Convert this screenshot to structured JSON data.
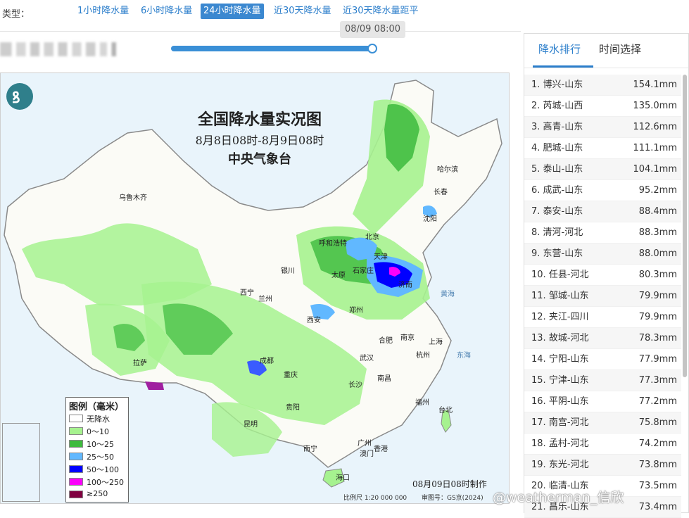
{
  "type_bar": {
    "label": "类型：",
    "tabs": [
      "1小时降水量",
      "6小时降水量",
      "24小时降水量",
      "近30天降水量",
      "近30天降水量距平"
    ],
    "active_index": 2
  },
  "timeline": {
    "current_time": "08/09 08:00",
    "progress": 1.0
  },
  "map": {
    "title": "全国降水量实况图",
    "subtitle": "8月8日08时-8月9日08时",
    "organization": "中央气象台",
    "made_time": "08月09日08时制作",
    "scale": "比例尺 1:20 000 000",
    "review_code": "审图号：GS京(2024)",
    "cities": [
      "哈尔滨",
      "长春",
      "沈阳",
      "乌鲁木齐",
      "呼和浩特",
      "北京",
      "天津",
      "银川",
      "太原",
      "石家庄",
      "西宁",
      "兰州",
      "西安",
      "郑州",
      "济南",
      "拉萨",
      "成都",
      "重庆",
      "武汉",
      "合肥",
      "南京",
      "上海",
      "杭州",
      "长沙",
      "南昌",
      "福州",
      "台北",
      "贵阳",
      "昆明",
      "南宁",
      "广州",
      "澳门",
      "香港",
      "海口"
    ],
    "sea_labels": [
      "黄海",
      "东海"
    ],
    "legend": {
      "title": "图例（毫米）",
      "items": [
        {
          "label": "无降水",
          "color": "#ffffff"
        },
        {
          "label": "0～10",
          "color": "#a6f28f"
        },
        {
          "label": "10～25",
          "color": "#3dba3d"
        },
        {
          "label": "25～50",
          "color": "#61b8ff"
        },
        {
          "label": "50～100",
          "color": "#0000ff"
        },
        {
          "label": "100～250",
          "color": "#fa00fa"
        },
        {
          "label": "≥250",
          "color": "#800040"
        }
      ]
    }
  },
  "ranking_panel": {
    "tabs": [
      "降水排行",
      "时间选择"
    ],
    "active_tab": 0,
    "items": [
      {
        "rank": "1.",
        "station": "博兴-山东",
        "value": "154.1mm"
      },
      {
        "rank": "2.",
        "station": "芮城-山西",
        "value": "135.0mm"
      },
      {
        "rank": "3.",
        "station": "高青-山东",
        "value": "112.6mm"
      },
      {
        "rank": "4.",
        "station": "肥城-山东",
        "value": "111.1mm"
      },
      {
        "rank": "5.",
        "station": "泰山-山东",
        "value": "104.1mm"
      },
      {
        "rank": "6.",
        "station": "成武-山东",
        "value": "95.2mm"
      },
      {
        "rank": "7.",
        "station": "泰安-山东",
        "value": "88.4mm"
      },
      {
        "rank": "8.",
        "station": "清河-河北",
        "value": "88.3mm"
      },
      {
        "rank": "9.",
        "station": "东营-山东",
        "value": "88.0mm"
      },
      {
        "rank": "10.",
        "station": "任县-河北",
        "value": "80.3mm"
      },
      {
        "rank": "11.",
        "station": "邹城-山东",
        "value": "79.9mm"
      },
      {
        "rank": "12.",
        "station": "夹江-四川",
        "value": "79.9mm"
      },
      {
        "rank": "13.",
        "station": "故城-河北",
        "value": "78.3mm"
      },
      {
        "rank": "14.",
        "station": "宁阳-山东",
        "value": "77.9mm"
      },
      {
        "rank": "15.",
        "station": "宁津-山东",
        "value": "77.3mm"
      },
      {
        "rank": "16.",
        "station": "平阴-山东",
        "value": "77.2mm"
      },
      {
        "rank": "17.",
        "station": "南宫-河北",
        "value": "75.8mm"
      },
      {
        "rank": "18.",
        "station": "孟村-河北",
        "value": "74.2mm"
      },
      {
        "rank": "19.",
        "station": "东光-河北",
        "value": "73.8mm"
      },
      {
        "rank": "20.",
        "station": "临清-山东",
        "value": "73.5mm"
      },
      {
        "rank": "21.",
        "station": "昌乐-山东",
        "value": "73.4mm"
      }
    ]
  },
  "watermark": "@weatherman_信欣"
}
